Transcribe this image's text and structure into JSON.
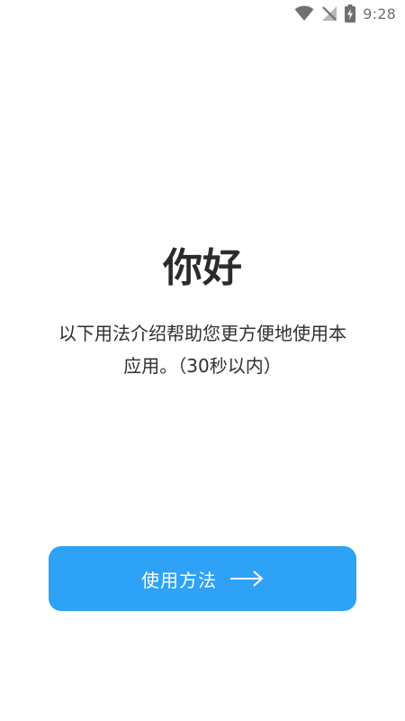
{
  "status_bar": {
    "time": "9:28",
    "icons": [
      "wifi-icon",
      "no-signal-icon",
      "battery-charging-icon"
    ],
    "icon_color": "#707070"
  },
  "main": {
    "greeting": "你好",
    "intro_line_1": "以下用法介绍帮助您更方便地使用本",
    "intro_line_2": "应用。（30秒以内）"
  },
  "button": {
    "label": "使用方法",
    "icon": "arrow-right-icon",
    "background": "#2ea2f6",
    "text_color": "#ffffff"
  }
}
